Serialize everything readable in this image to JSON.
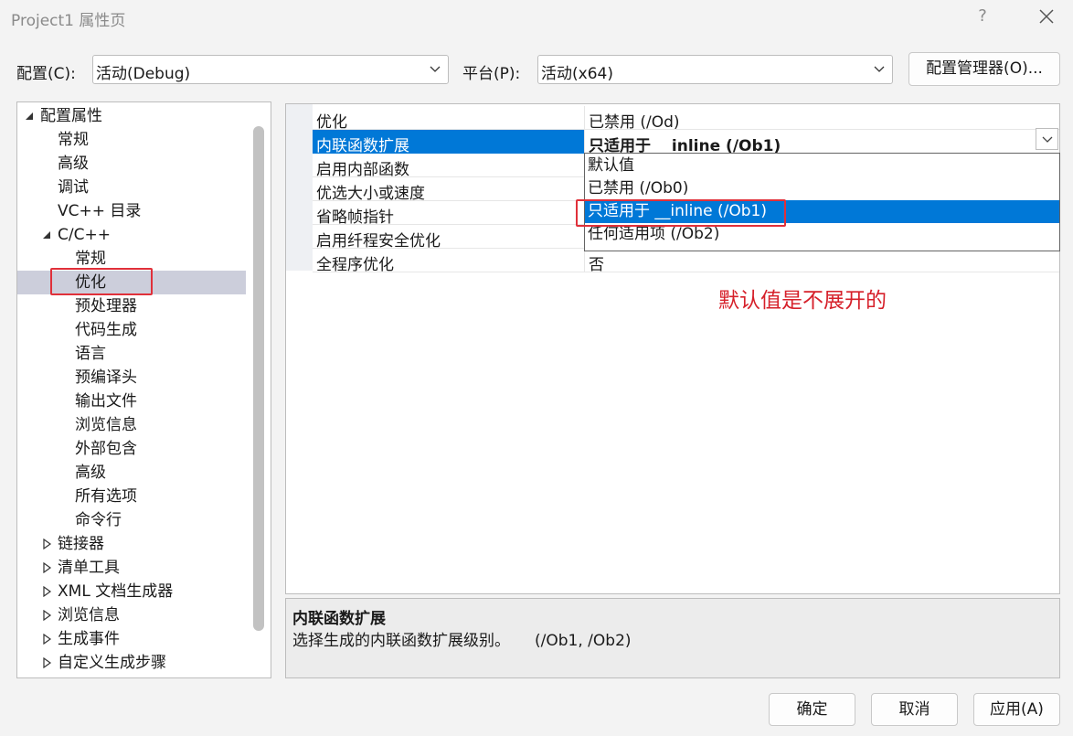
{
  "window": {
    "title": "Project1 属性页",
    "help_glyph": "?"
  },
  "toolbar": {
    "config_label": "配置(C):",
    "config_value": "活动(Debug)",
    "platform_label": "平台(P):",
    "platform_value": "活动(x64)",
    "config_manager_label": "配置管理器(O)..."
  },
  "tree": {
    "items": [
      {
        "label": "配置属性",
        "level": 0,
        "expander": "expanded"
      },
      {
        "label": "常规",
        "level": 1
      },
      {
        "label": "高级",
        "level": 1
      },
      {
        "label": "调试",
        "level": 1
      },
      {
        "label": "VC++ 目录",
        "level": 1
      },
      {
        "label": "C/C++",
        "level": 1,
        "expander": "expanded"
      },
      {
        "label": "常规",
        "level": 2
      },
      {
        "label": "优化",
        "level": 2,
        "selected": true
      },
      {
        "label": "预处理器",
        "level": 2
      },
      {
        "label": "代码生成",
        "level": 2
      },
      {
        "label": "语言",
        "level": 2
      },
      {
        "label": "预编译头",
        "level": 2
      },
      {
        "label": "输出文件",
        "level": 2
      },
      {
        "label": "浏览信息",
        "level": 2
      },
      {
        "label": "外部包含",
        "level": 2
      },
      {
        "label": "高级",
        "level": 2
      },
      {
        "label": "所有选项",
        "level": 2
      },
      {
        "label": "命令行",
        "level": 2
      },
      {
        "label": "链接器",
        "level": 1,
        "expander": "collapsed"
      },
      {
        "label": "清单工具",
        "level": 1,
        "expander": "collapsed"
      },
      {
        "label": "XML 文档生成器",
        "level": 1,
        "expander": "collapsed"
      },
      {
        "label": "浏览信息",
        "level": 1,
        "expander": "collapsed"
      },
      {
        "label": "生成事件",
        "level": 1,
        "expander": "collapsed"
      },
      {
        "label": "自定义生成步骤",
        "level": 1,
        "expander": "collapsed"
      }
    ]
  },
  "properties": {
    "rows": [
      {
        "name": "优化",
        "value": "已禁用 (/Od)"
      },
      {
        "name": "内联函数扩展",
        "value": "只适用于 __inline (/Ob1)",
        "active": true
      },
      {
        "name": "启用内部函数",
        "value": ""
      },
      {
        "name": "优选大小或速度",
        "value": ""
      },
      {
        "name": "省略帧指针",
        "value": ""
      },
      {
        "name": "启用纤程安全优化",
        "value": ""
      },
      {
        "name": "全程序优化",
        "value": "否"
      }
    ]
  },
  "dropdown": {
    "options": [
      {
        "label": "默认值"
      },
      {
        "label": "已禁用 (/Ob0)"
      },
      {
        "label": "只适用于 __inline (/Ob1)",
        "selected": true
      },
      {
        "label": "任何适用项 (/Ob2)"
      }
    ]
  },
  "annotation": {
    "text": "默认值是不展开的",
    "color": "#d6202a"
  },
  "description": {
    "title": "内联函数扩展",
    "text": "选择生成的内联函数扩展级别。     (/Ob1, /Ob2)"
  },
  "buttons": {
    "ok": "确定",
    "cancel": "取消",
    "apply": "应用(A)"
  },
  "colors": {
    "accent": "#0078d7",
    "tree_selected": "#cccedb",
    "highlight_box": "#e0303a"
  }
}
